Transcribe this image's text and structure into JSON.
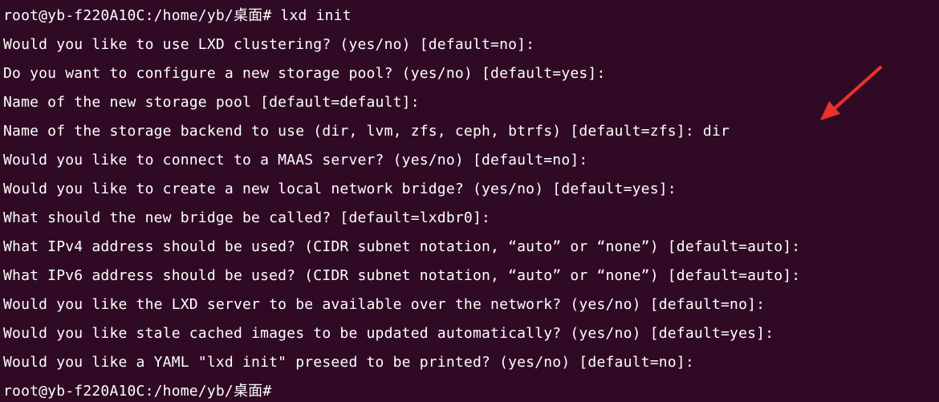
{
  "terminal": {
    "lines": [
      "root@yb-f220A10C:/home/yb/桌面# lxd init",
      "Would you like to use LXD clustering? (yes/no) [default=no]:",
      "Do you want to configure a new storage pool? (yes/no) [default=yes]:",
      "Name of the new storage pool [default=default]:",
      "Name of the storage backend to use (dir, lvm, zfs, ceph, btrfs) [default=zfs]: dir",
      "Would you like to connect to a MAAS server? (yes/no) [default=no]:",
      "Would you like to create a new local network bridge? (yes/no) [default=yes]:",
      "What should the new bridge be called? [default=lxdbr0]:",
      "What IPv4 address should be used? (CIDR subnet notation, “auto” or “none”) [default=auto]:",
      "What IPv6 address should be used? (CIDR subnet notation, “auto” or “none”) [default=auto]:",
      "Would you like the LXD server to be available over the network? (yes/no) [default=no]:",
      "Would you like stale cached images to be updated automatically? (yes/no) [default=yes]:",
      "Would you like a YAML \"lxd init\" preseed to be printed? (yes/no) [default=no]:",
      "root@yb-f220A10C:/home/yb/桌面#"
    ]
  },
  "colors": {
    "background": "#300a24",
    "text": "#ffffff",
    "annotation_arrow": "#e8322b"
  },
  "icons": {
    "annotation": "red-arrow-icon"
  }
}
